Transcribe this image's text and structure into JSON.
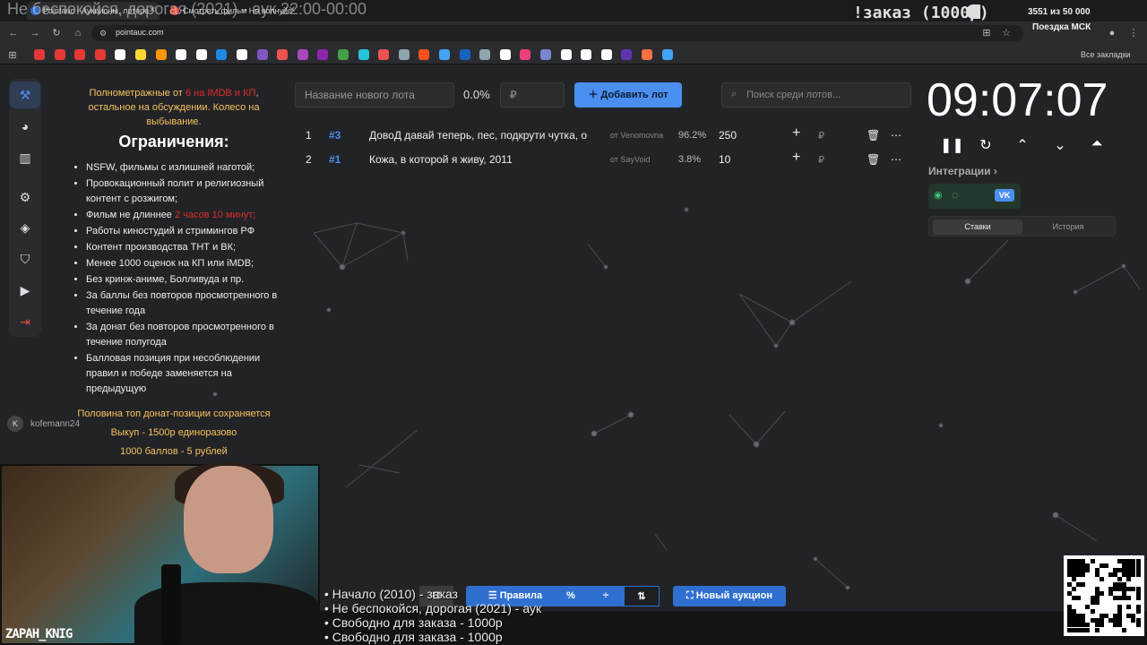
{
  "browser": {
    "tabs": [
      {
        "label": "Pointauc - Аукционы, лотере",
        "color": "#2f6fd0"
      },
      {
        "label": "Смотреть фильм Не волнуйс",
        "color": "#e84b3c"
      }
    ],
    "url": "pointauc.com",
    "bookmarks_all": "Все закладки",
    "bookmark_colors": [
      "#e53935",
      "#e53935",
      "#e53935",
      "#e53935",
      "#ffffff",
      "#fdd835",
      "#ff9800",
      "#ffffff",
      "#ffffff",
      "#1e88e5",
      "#ffffff",
      "#7e57c2",
      "#ef5350",
      "#ab47bc",
      "#8e24aa",
      "#43a047",
      "#26c6da",
      "#ef5350",
      "#90a4ae",
      "#f4511e",
      "#42a5f5",
      "#1565c0",
      "#90a4ae",
      "#ffffff",
      "#ec407a",
      "#7986cb",
      "#ffffff",
      "#ffffff",
      "#ffffff",
      "#5e35b1",
      "#ff7043",
      "#42a5f5"
    ]
  },
  "overlay": {
    "title": "Не беспокойся, дорогая (2021) - аук 22:00-00:00",
    "zakaz": "!заказ (1000р)",
    "counter": "3551  из 50 000",
    "poezdka": "Поездка МСК"
  },
  "rules": {
    "intro_a": "Полнометражные от ",
    "intro_red": "6 на IMDB и КП",
    "intro_b": ", остальное на обсуждении. Колесо на выбывание.",
    "heading": "Ограничения:",
    "items": [
      "NSFW, фильмы с излишней наготой;",
      "Провокационный полит и религиозный контент с розжигом;",
      "Фильм не длиннее ",
      "Работы киностудий и стримингов РФ",
      "Контент производства ТНТ и ВК;",
      "Менее 1000 оценок на КП или iMDB;",
      "Без кринж-аниме, Болливуда и пр.",
      "За баллы без повторов просмотренного в течение года",
      "За донат без повторов просмотренного в течение полугода",
      "Балловая позиция при несоблюдении правил и победе заменяется на предыдущую"
    ],
    "len_red": "2 часов 10 минут;",
    "half": "Половина топ донат-позиции сохраняется",
    "buyout": "Выкуп - 1500р единоразово",
    "points": "1000 баллов - 5 рублей"
  },
  "chat": {
    "initial": "K",
    "user": "kofemann24"
  },
  "streamer": "ZAPAH_KNIG",
  "auction": {
    "new_lot_placeholder": "Название нового лота",
    "percent": "0.0%",
    "currency": "₽",
    "add_button": "Добавить лот",
    "search_placeholder": "Поиск среди лотов...",
    "lots": [
      {
        "num": "1",
        "hash": "#3",
        "name": "ДовоД давай теперь, пес, подкрути чутка, о",
        "from": "от Venomovna",
        "pct": "96.2%",
        "amount": "250",
        "rub": "₽"
      },
      {
        "num": "2",
        "hash": "#1",
        "name": "Кожа, в которой я живу, 2011",
        "from": "от SayVoid",
        "pct": "3.8%",
        "amount": "10",
        "rub": "₽"
      }
    ]
  },
  "timer": "09:07:07",
  "integrations": {
    "label": "Интеграции",
    "tab_bets": "Ставки",
    "tab_history": "История",
    "vk": "VK"
  },
  "bottom": {
    "rules_btn": "Правила",
    "new_auction": "Новый аукцион",
    "ticker": [
      "• Начало (2010) - заказ",
      "• Не беспокойся, дорогая (2021) - аук",
      "• Свободно для заказа - 1000р",
      "• Свободно для заказа - 1000р"
    ]
  }
}
